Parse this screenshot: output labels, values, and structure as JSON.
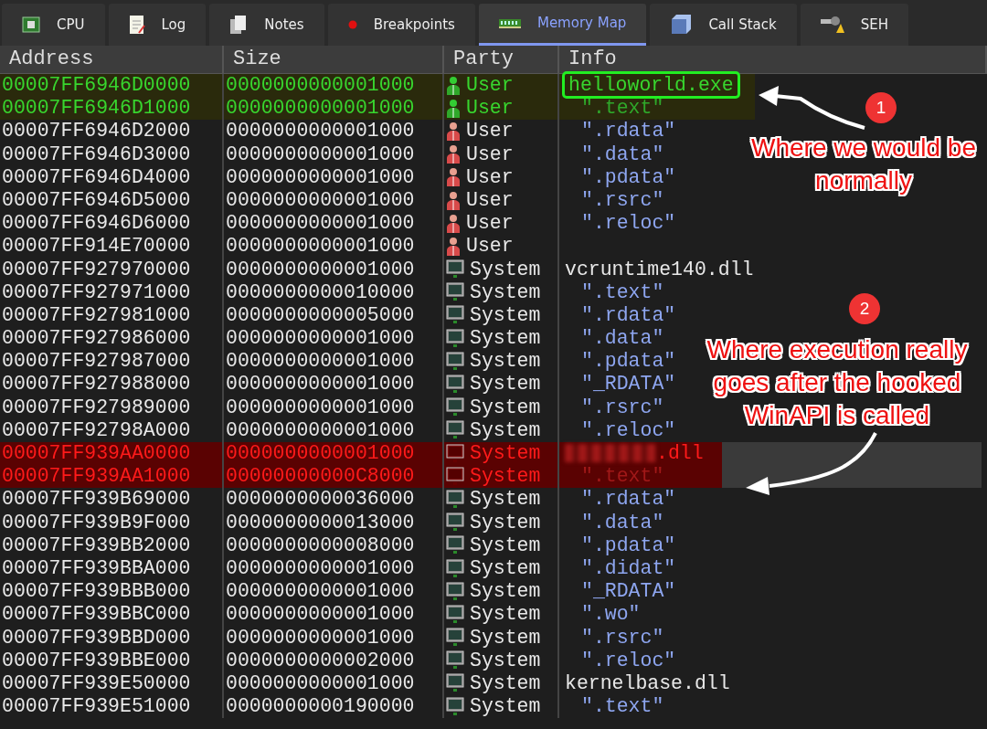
{
  "tabs": [
    {
      "label": "CPU",
      "selected": false
    },
    {
      "label": "Log",
      "selected": false
    },
    {
      "label": "Notes",
      "selected": false
    },
    {
      "label": "Breakpoints",
      "selected": false
    },
    {
      "label": "Memory Map",
      "selected": true
    },
    {
      "label": "Call Stack",
      "selected": false
    },
    {
      "label": "SEH",
      "selected": false
    }
  ],
  "table": {
    "columns": [
      "Address",
      "Size",
      "Party",
      "Info"
    ],
    "rows": [
      {
        "address": "00007FF6946D0000",
        "size": "0000000000001000",
        "party": "User",
        "info": "helloworld.exe",
        "kind": "module",
        "current": true,
        "boxed": true
      },
      {
        "address": "00007FF6946D1000",
        "size": "0000000000001000",
        "party": "User",
        "info": "\".text\"",
        "kind": "section",
        "current": true
      },
      {
        "address": "00007FF6946D2000",
        "size": "0000000000001000",
        "party": "User",
        "info": "\".rdata\"",
        "kind": "section"
      },
      {
        "address": "00007FF6946D3000",
        "size": "0000000000001000",
        "party": "User",
        "info": "\".data\"",
        "kind": "section"
      },
      {
        "address": "00007FF6946D4000",
        "size": "0000000000001000",
        "party": "User",
        "info": "\".pdata\"",
        "kind": "section"
      },
      {
        "address": "00007FF6946D5000",
        "size": "0000000000001000",
        "party": "User",
        "info": "\".rsrc\"",
        "kind": "section"
      },
      {
        "address": "00007FF6946D6000",
        "size": "0000000000001000",
        "party": "User",
        "info": "\".reloc\"",
        "kind": "section"
      },
      {
        "address": "00007FF914E70000",
        "size": "0000000000001000",
        "party": "User",
        "kind": "none"
      },
      {
        "address": "00007FF927970000",
        "size": "0000000000001000",
        "party": "System",
        "info": "vcruntime140.dll",
        "kind": "module"
      },
      {
        "address": "00007FF927971000",
        "size": "0000000000010000",
        "party": "System",
        "info": "\".text\"",
        "kind": "section"
      },
      {
        "address": "00007FF927981000",
        "size": "0000000000005000",
        "party": "System",
        "info": "\".rdata\"",
        "kind": "section"
      },
      {
        "address": "00007FF927986000",
        "size": "0000000000001000",
        "party": "System",
        "info": "\".data\"",
        "kind": "section"
      },
      {
        "address": "00007FF927987000",
        "size": "0000000000001000",
        "party": "System",
        "info": "\".pdata\"",
        "kind": "section"
      },
      {
        "address": "00007FF927988000",
        "size": "0000000000001000",
        "party": "System",
        "info": "\"_RDATA\"",
        "kind": "section"
      },
      {
        "address": "00007FF927989000",
        "size": "0000000000001000",
        "party": "System",
        "info": "\".rsrc\"",
        "kind": "section"
      },
      {
        "address": "00007FF92798A000",
        "size": "0000000000001000",
        "party": "System",
        "info": "\".reloc\"",
        "kind": "section"
      },
      {
        "address": "00007FF939AA0000",
        "size": "0000000000001000",
        "party": "System",
        "info": ".dll",
        "kind": "module",
        "hooked": true,
        "redacted": true
      },
      {
        "address": "00007FF939AA1000",
        "size": "00000000000C8000",
        "party": "System",
        "info": "\".text\"",
        "kind": "section",
        "hooked": true
      },
      {
        "address": "00007FF939B69000",
        "size": "0000000000036000",
        "party": "System",
        "info": "\".rdata\"",
        "kind": "section"
      },
      {
        "address": "00007FF939B9F000",
        "size": "0000000000013000",
        "party": "System",
        "info": "\".data\"",
        "kind": "section"
      },
      {
        "address": "00007FF939BB2000",
        "size": "0000000000008000",
        "party": "System",
        "info": "\".pdata\"",
        "kind": "section"
      },
      {
        "address": "00007FF939BBA000",
        "size": "0000000000001000",
        "party": "System",
        "info": "\".didat\"",
        "kind": "section"
      },
      {
        "address": "00007FF939BBB000",
        "size": "0000000000001000",
        "party": "System",
        "info": "\"_RDATA\"",
        "kind": "section"
      },
      {
        "address": "00007FF939BBC000",
        "size": "0000000000001000",
        "party": "System",
        "info": "\".wo\"",
        "kind": "section"
      },
      {
        "address": "00007FF939BBD000",
        "size": "0000000000001000",
        "party": "System",
        "info": "\".rsrc\"",
        "kind": "section"
      },
      {
        "address": "00007FF939BBE000",
        "size": "0000000000002000",
        "party": "System",
        "info": "\".reloc\"",
        "kind": "section"
      },
      {
        "address": "00007FF939E50000",
        "size": "0000000000001000",
        "party": "System",
        "info": "kernelbase.dll",
        "kind": "module"
      },
      {
        "address": "00007FF939E51000",
        "size": "0000000000190000",
        "party": "System",
        "info": "\".text\"",
        "kind": "section"
      }
    ]
  },
  "annotations": [
    {
      "number": "1",
      "text": "Where we would be normally"
    },
    {
      "number": "2",
      "text": "Where execution really goes after the hooked WinAPI is called"
    }
  ]
}
